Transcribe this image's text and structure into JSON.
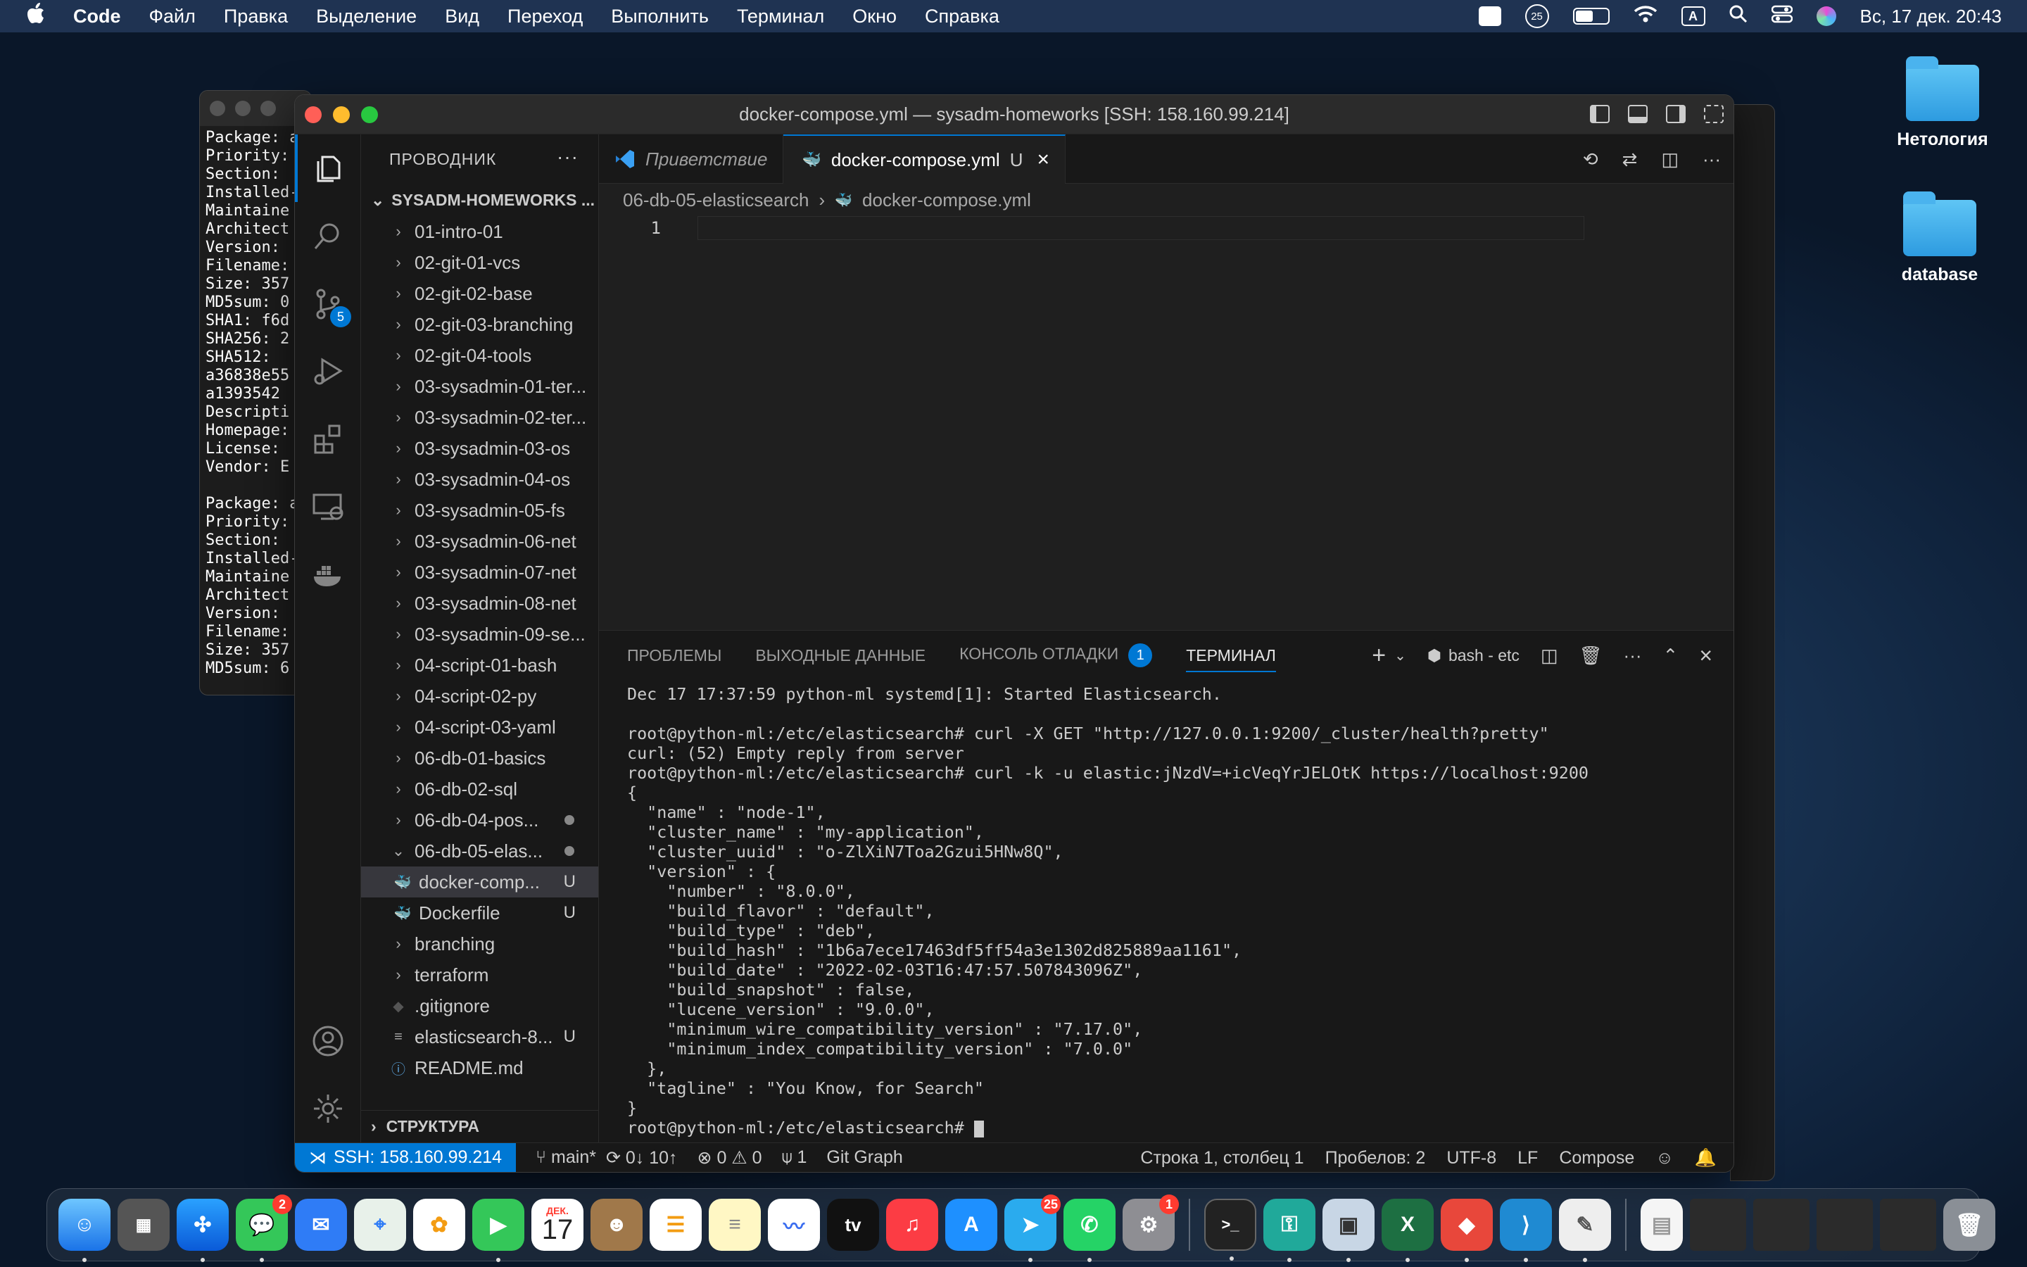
{
  "menubar": {
    "app": "Code",
    "items": [
      "Файл",
      "Правка",
      "Выделение",
      "Вид",
      "Переход",
      "Выполнить",
      "Терминал",
      "Окно",
      "Справка"
    ],
    "clock": "Вс, 17 дек.  20:43",
    "input_source": "A",
    "notification_count": "25"
  },
  "desktop": {
    "folders": [
      "Нетология",
      "database"
    ]
  },
  "bg_terminal": {
    "lines": "Package: a\nPriority: \nSection: \nInstalled-\nMaintaine\nArchitect\nVersion: \nFilename: \nSize: 357\nMD5sum: 0\nSHA1: f6d\nSHA256: 2\nSHA512: \na36838e55\na1393542\nDescripti\nHomepage: \nLicense: \nVendor: E\n\nPackage: a\nPriority: \nSection: \nInstalled-\nMaintaine\nArchitect\nVersion: \nFilename: \nSize: 357\nMD5sum: 6"
  },
  "window": {
    "title": "docker-compose.yml — sysadm-homeworks [SSH: 158.160.99.214]"
  },
  "activity": {
    "scm_badge": "5"
  },
  "sidebar": {
    "header": "ПРОВОДНИК",
    "more": "···",
    "root": "SYSADM-HOMEWORKS ...",
    "items": [
      {
        "label": "01-intro-01"
      },
      {
        "label": "02-git-01-vcs"
      },
      {
        "label": "02-git-02-base"
      },
      {
        "label": "02-git-03-branching"
      },
      {
        "label": "02-git-04-tools"
      },
      {
        "label": "03-sysadmin-01-ter..."
      },
      {
        "label": "03-sysadmin-02-ter..."
      },
      {
        "label": "03-sysadmin-03-os"
      },
      {
        "label": "03-sysadmin-04-os"
      },
      {
        "label": "03-sysadmin-05-fs"
      },
      {
        "label": "03-sysadmin-06-net"
      },
      {
        "label": "03-sysadmin-07-net"
      },
      {
        "label": "03-sysadmin-08-net"
      },
      {
        "label": "03-sysadmin-09-se..."
      },
      {
        "label": "04-script-01-bash"
      },
      {
        "label": "04-script-02-py"
      },
      {
        "label": "04-script-03-yaml"
      },
      {
        "label": "06-db-01-basics"
      },
      {
        "label": "06-db-02-sql"
      },
      {
        "label": "06-db-04-pos..."
      },
      {
        "label": "06-db-05-elas..."
      },
      {
        "label": "docker-comp...",
        "badge": "U"
      },
      {
        "label": "Dockerfile",
        "badge": "U"
      },
      {
        "label": "branching"
      },
      {
        "label": "terraform"
      },
      {
        "label": ".gitignore"
      },
      {
        "label": "elasticsearch-8...",
        "badge": "U"
      },
      {
        "label": "README.md"
      }
    ],
    "outline": "СТРУКТУРА"
  },
  "editor": {
    "tabs": [
      {
        "label": "Приветствие"
      },
      {
        "label": "docker-compose.yml",
        "badge": "U"
      }
    ],
    "breadcrumb": [
      "06-db-05-elasticsearch",
      "docker-compose.yml"
    ],
    "line_number": "1"
  },
  "panel": {
    "tabs": [
      "ПРОБЛЕМЫ",
      "ВЫХОДНЫЕ ДАННЫЕ",
      "КОНСОЛЬ ОТЛАДКИ",
      "ТЕРМИНАЛ"
    ],
    "debug_badge": "1",
    "shell": "bash - etc",
    "terminal": "Dec 17 17:37:59 python-ml systemd[1]: Started Elasticsearch.\n\nroot@python-ml:/etc/elasticsearch# curl -X GET \"http://127.0.0.1:9200/_cluster/health?pretty\"\ncurl: (52) Empty reply from server\nroot@python-ml:/etc/elasticsearch# curl -k -u elastic:jNzdV=+icVeqYrJELOtK https://localhost:9200\n{\n  \"name\" : \"node-1\",\n  \"cluster_name\" : \"my-application\",\n  \"cluster_uuid\" : \"o-ZlXiN7Toa2Gzui5HNw8Q\",\n  \"version\" : {\n    \"number\" : \"8.0.0\",\n    \"build_flavor\" : \"default\",\n    \"build_type\" : \"deb\",\n    \"build_hash\" : \"1b6a7ece17463df5ff54a3e1302d825889aa1161\",\n    \"build_date\" : \"2022-02-03T16:47:57.507843096Z\",\n    \"build_snapshot\" : false,\n    \"lucene_version\" : \"9.0.0\",\n    \"minimum_wire_compatibility_version\" : \"7.17.0\",\n    \"minimum_index_compatibility_version\" : \"7.0.0\"\n  },\n  \"tagline\" : \"You Know, for Search\"\n}",
    "prompt": "root@python-ml:/etc/elasticsearch# "
  },
  "statusbar": {
    "remote": "SSH: 158.160.99.214",
    "branch": "main*",
    "sync": "0↓ 10↑",
    "errors": "0",
    "warnings": "0",
    "ports": "1",
    "git_graph": "Git Graph",
    "position": "Строка 1, столбец 1",
    "spaces": "Пробелов: 2",
    "encoding": "UTF-8",
    "eol": "LF",
    "language": "Compose"
  },
  "dock": {
    "badges": {
      "messages": "2",
      "telegram": "25",
      "settings": "1"
    },
    "calendar_month": "ДЕК.",
    "calendar_day": "17",
    "tv": "tv"
  }
}
